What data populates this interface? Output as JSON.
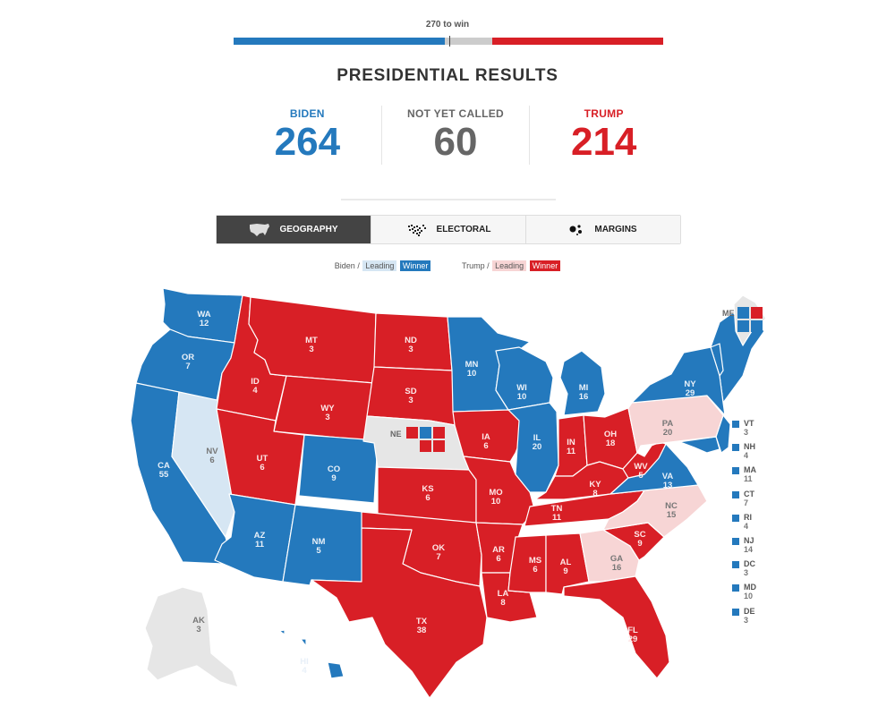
{
  "header": {
    "to_win_label": "270 to win",
    "title": "PRESIDENTIAL RESULTS"
  },
  "progress": {
    "total": 538,
    "dem_votes": 264,
    "undecided_votes": 60,
    "rep_votes": 214,
    "threshold": 270
  },
  "tallies": [
    {
      "label": "BIDEN",
      "value": "264",
      "party": "dem"
    },
    {
      "label": "NOT YET CALLED",
      "value": "60",
      "party": "und"
    },
    {
      "label": "TRUMP",
      "value": "214",
      "party": "rep"
    }
  ],
  "tabs": [
    {
      "label": "GEOGRAPHY",
      "icon": "us-map-icon",
      "active": true
    },
    {
      "label": "ELECTORAL",
      "icon": "electoral-map-icon",
      "active": false
    },
    {
      "label": "MARGINS",
      "icon": "margins-dots-icon",
      "active": false
    }
  ],
  "legend": {
    "biden_label": "Biden /",
    "trump_label": "Trump /",
    "leading": "Leading",
    "winner": "Winner"
  },
  "colors": {
    "dem_winner": "#2479bd",
    "dem_leading": "#d6e6f3",
    "rep_winner": "#d81f26",
    "rep_leading": "#f7d5d5",
    "undecided": "#e6e6e6"
  },
  "states": [
    {
      "code": "WA",
      "ev": "12",
      "status": "dem_winner"
    },
    {
      "code": "OR",
      "ev": "7",
      "status": "dem_winner"
    },
    {
      "code": "CA",
      "ev": "55",
      "status": "dem_winner"
    },
    {
      "code": "NV",
      "ev": "6",
      "status": "dem_leading"
    },
    {
      "code": "ID",
      "ev": "4",
      "status": "rep_winner"
    },
    {
      "code": "MT",
      "ev": "3",
      "status": "rep_winner"
    },
    {
      "code": "WY",
      "ev": "3",
      "status": "rep_winner"
    },
    {
      "code": "UT",
      "ev": "6",
      "status": "rep_winner"
    },
    {
      "code": "AZ",
      "ev": "11",
      "status": "dem_winner"
    },
    {
      "code": "CO",
      "ev": "9",
      "status": "dem_winner"
    },
    {
      "code": "NM",
      "ev": "5",
      "status": "dem_winner"
    },
    {
      "code": "ND",
      "ev": "3",
      "status": "rep_winner"
    },
    {
      "code": "SD",
      "ev": "3",
      "status": "rep_winner"
    },
    {
      "code": "NE",
      "ev": "",
      "status": "undecided"
    },
    {
      "code": "KS",
      "ev": "6",
      "status": "rep_winner"
    },
    {
      "code": "OK",
      "ev": "7",
      "status": "rep_winner"
    },
    {
      "code": "TX",
      "ev": "38",
      "status": "rep_winner"
    },
    {
      "code": "MN",
      "ev": "10",
      "status": "dem_winner"
    },
    {
      "code": "IA",
      "ev": "6",
      "status": "rep_winner"
    },
    {
      "code": "MO",
      "ev": "10",
      "status": "rep_winner"
    },
    {
      "code": "AR",
      "ev": "6",
      "status": "rep_winner"
    },
    {
      "code": "LA",
      "ev": "8",
      "status": "rep_winner"
    },
    {
      "code": "WI",
      "ev": "10",
      "status": "dem_winner"
    },
    {
      "code": "IL",
      "ev": "20",
      "status": "dem_winner"
    },
    {
      "code": "MI",
      "ev": "16",
      "status": "dem_winner"
    },
    {
      "code": "IN",
      "ev": "11",
      "status": "rep_winner"
    },
    {
      "code": "OH",
      "ev": "18",
      "status": "rep_winner"
    },
    {
      "code": "KY",
      "ev": "8",
      "status": "rep_winner"
    },
    {
      "code": "TN",
      "ev": "11",
      "status": "rep_winner"
    },
    {
      "code": "MS",
      "ev": "6",
      "status": "rep_winner"
    },
    {
      "code": "AL",
      "ev": "9",
      "status": "rep_winner"
    },
    {
      "code": "GA",
      "ev": "16",
      "status": "rep_leading"
    },
    {
      "code": "FL",
      "ev": "29",
      "status": "rep_winner"
    },
    {
      "code": "SC",
      "ev": "9",
      "status": "rep_winner"
    },
    {
      "code": "NC",
      "ev": "15",
      "status": "rep_leading"
    },
    {
      "code": "VA",
      "ev": "13",
      "status": "dem_winner"
    },
    {
      "code": "WV",
      "ev": "5",
      "status": "rep_winner"
    },
    {
      "code": "PA",
      "ev": "20",
      "status": "rep_leading"
    },
    {
      "code": "NY",
      "ev": "29",
      "status": "dem_winner"
    },
    {
      "code": "ME",
      "ev": "",
      "status": "undecided"
    },
    {
      "code": "AK",
      "ev": "3",
      "status": "undecided"
    },
    {
      "code": "HI",
      "ev": "4",
      "status": "dem_winner"
    }
  ],
  "small_states": [
    {
      "code": "VT",
      "ev": "3"
    },
    {
      "code": "NH",
      "ev": "4"
    },
    {
      "code": "MA",
      "ev": "11"
    },
    {
      "code": "CT",
      "ev": "7"
    },
    {
      "code": "RI",
      "ev": "4"
    },
    {
      "code": "NJ",
      "ev": "14"
    },
    {
      "code": "DC",
      "ev": "3"
    },
    {
      "code": "MD",
      "ev": "10"
    },
    {
      "code": "DE",
      "ev": "3"
    }
  ],
  "split_states": {
    "ME": {
      "code": "ME",
      "districts": [
        "dem_winner",
        "rep_winner",
        "dem_winner",
        "dem_winner"
      ]
    },
    "NE": {
      "code": "NE",
      "districts": [
        "rep_winner",
        "dem_winner",
        "rep_winner",
        "rep_winner",
        "rep_winner"
      ]
    }
  }
}
